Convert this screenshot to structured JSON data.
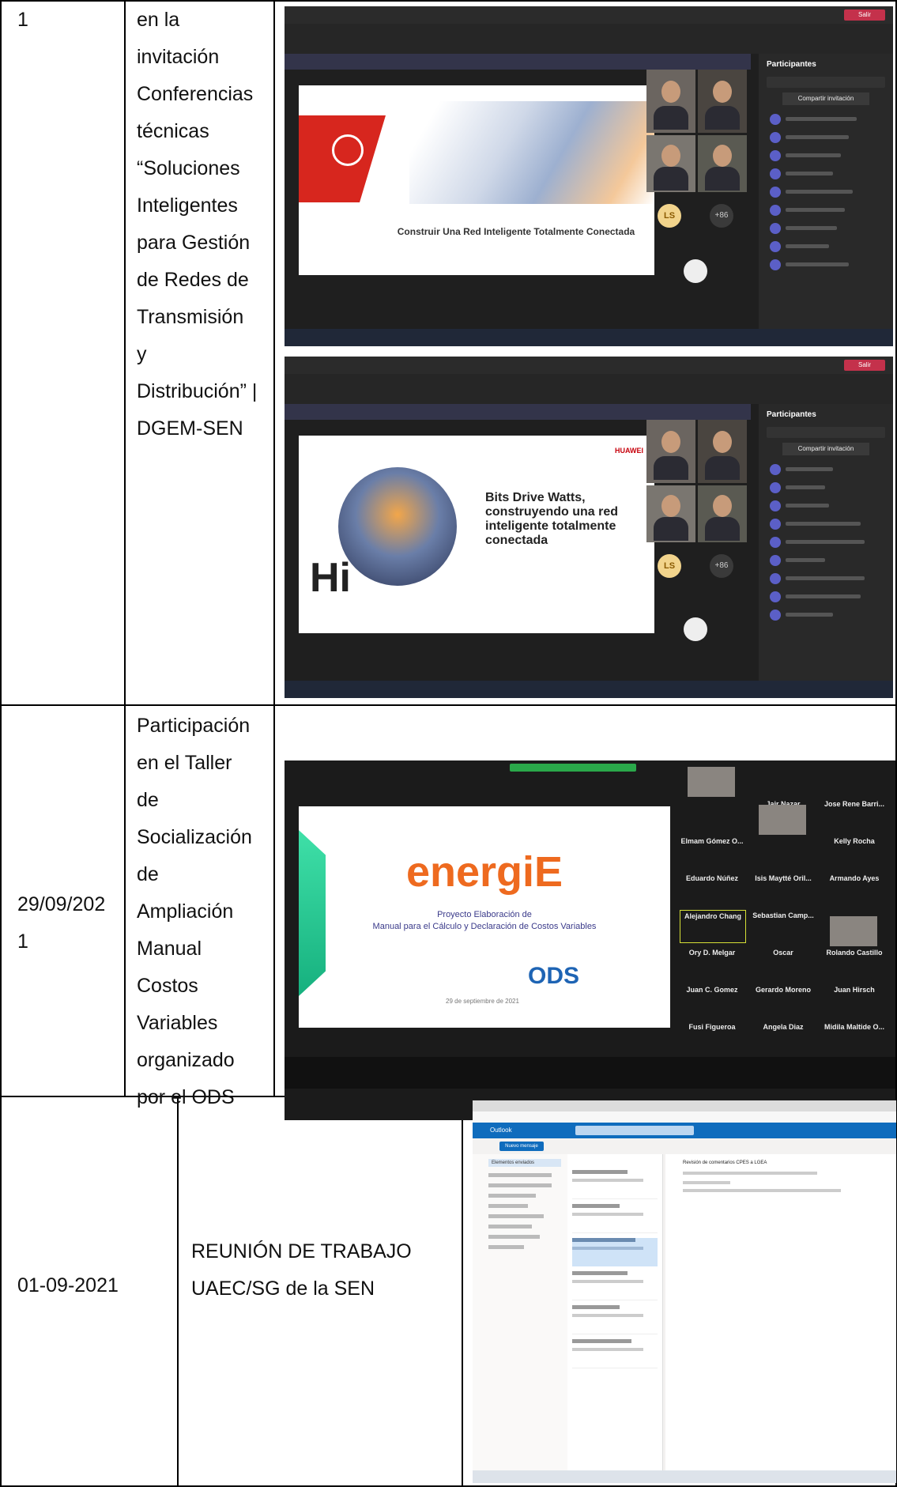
{
  "rows": [
    {
      "num": "1",
      "activity_lines": [
        "en la",
        "invitación",
        "Conferencias",
        "técnicas",
        "“Soluciones",
        "Inteligentes",
        "para Gestión",
        "de Redes de",
        "Transmisión",
        "y",
        "Distribución” |",
        "DGEM-SEN"
      ]
    },
    {
      "date_lines": [
        "29/09/202",
        "1"
      ],
      "activity_lines": [
        "Participación",
        "en el Taller",
        "de",
        "Socialización",
        "de",
        "Ampliación",
        "Manual",
        "Costos",
        "Variables",
        "organizado",
        "por el ODS"
      ]
    },
    {
      "date": "01-09-2021",
      "activity_lines": [
        "REUNIÓN DE TRABAJO",
        "UAEC/SG de la SEN"
      ]
    }
  ],
  "screens": {
    "teams1": {
      "slide_title": "Construir Una Red Inteligente Totalmente Conectada",
      "panel_title": "Participantes",
      "share_label": "Compartir invitación",
      "leave_label": "Salir",
      "avatar_initials": "LS"
    },
    "teams2": {
      "brand": "HUAWEI",
      "slide_lines": [
        "Bits Drive Watts,",
        "construyendo una red",
        "inteligente totalmente",
        "conectada"
      ],
      "hi_text": "Hi",
      "panel_title": "Participantes",
      "share_label": "Compartir invitación",
      "leave_label": "Salir",
      "avatar_initials": "LS"
    },
    "zoom": {
      "logo_text": "energiE",
      "subtitle_lines": [
        "Proyecto Elaboración de",
        "Manual para el Cálculo y Declaración de Costos Variables"
      ],
      "ods_text": "ODS",
      "date_text": "29 de septiembre de 2021",
      "tiles": [
        {
          "name": "Jair Nazar"
        },
        {
          "name": "Jose Rene Barri..."
        },
        {
          "name": "Elmam Gómez O..."
        },
        {
          "name": "Kelly Rocha"
        },
        {
          "name": "Eduardo Núñez"
        },
        {
          "name": "Isis Maytté Oril..."
        },
        {
          "name": "Armando Ayes"
        },
        {
          "name": "Alejandro Chang"
        },
        {
          "name": "Sebastian Camp..."
        },
        {
          "name": "Ory D. Melgar"
        },
        {
          "name": "Oscar"
        },
        {
          "name": "Rolando Castillo"
        },
        {
          "name": "Juan C. Gomez"
        },
        {
          "name": "Gerardo Moreno"
        },
        {
          "name": "Juan Hirsch"
        },
        {
          "name": "Fusi Figueroa"
        },
        {
          "name": "Angela Diaz"
        },
        {
          "name": "Midila Maltide O..."
        }
      ]
    },
    "outlook": {
      "app_name": "Outlook",
      "new_message": "Nuevo mensaje",
      "folder_label": "Elementos enviados",
      "email_subject": "Revisión de comentarios CPES a LGEA"
    }
  }
}
